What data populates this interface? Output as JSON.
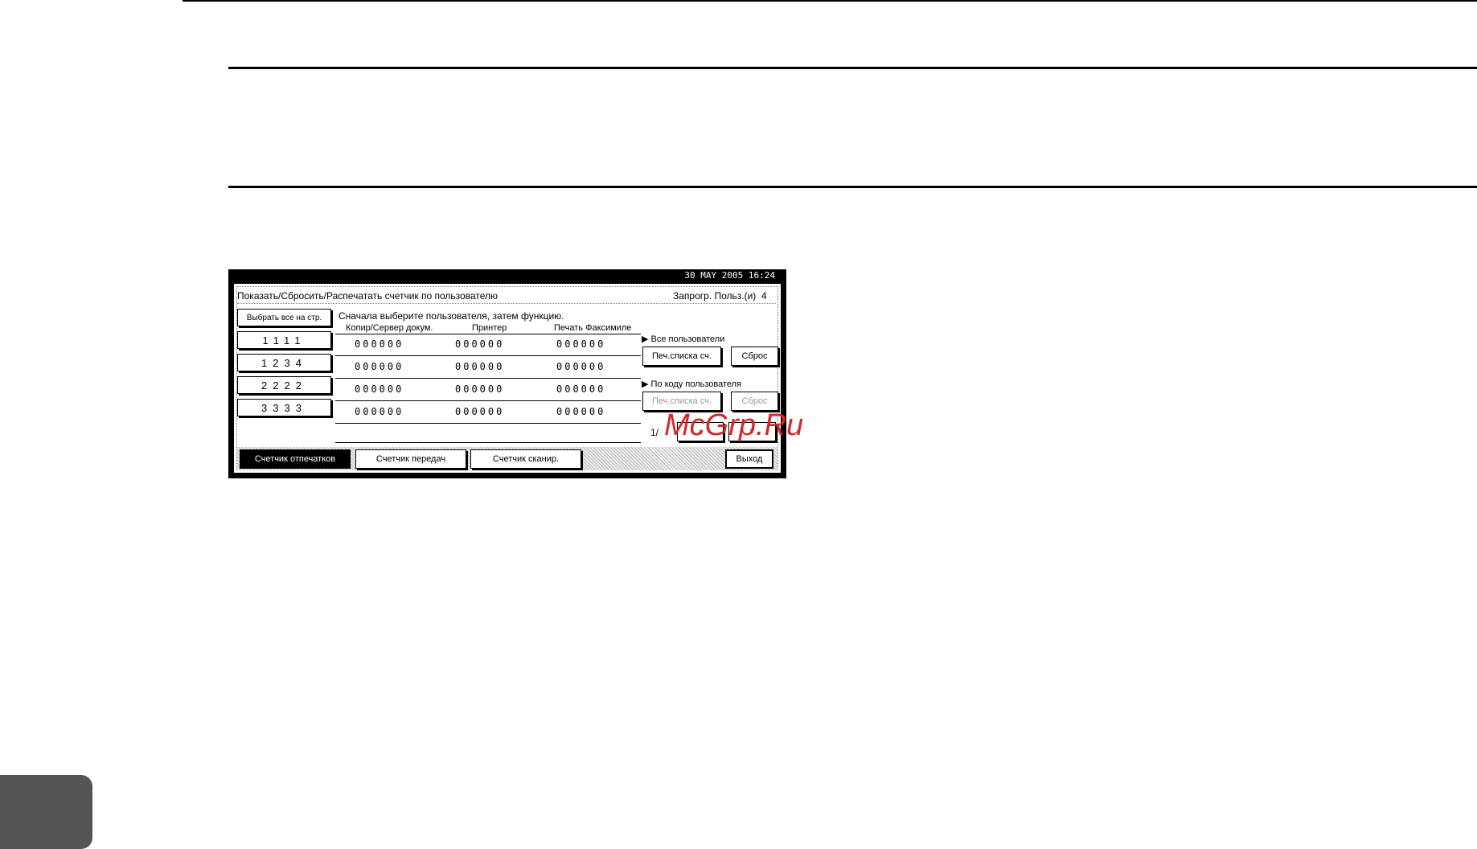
{
  "screen": {
    "datetime": "30 MAY  2005 16:24",
    "title": "Показать/Сбросить/Распечатать счетчик по пользователю",
    "registered_label": "Запрогр. Польз.(и)",
    "registered_count": "4",
    "select_all_label": "Выбрать все на стр.",
    "instruction": "Сначала выберите пользователя, затем функцию.",
    "columns": [
      "Копир/Сервер докум.",
      "Принтер",
      "Печать Факсимиле"
    ],
    "users": [
      {
        "code": "1111",
        "copy": "000000",
        "printer": "000000",
        "fax": "000000"
      },
      {
        "code": "1234",
        "copy": "000000",
        "printer": "000000",
        "fax": "000000"
      },
      {
        "code": "2222",
        "copy": "000000",
        "printer": "000000",
        "fax": "000000"
      },
      {
        "code": "3333",
        "copy": "000000",
        "printer": "000000",
        "fax": "000000"
      }
    ],
    "all_users_label": "▶ Все пользователи",
    "print_list_label": "Печ.списка сч.",
    "reset_label": "Сброс",
    "by_code_label": "▶ По коду пользователя",
    "page_indicator": "1/",
    "prev_label": "▲",
    "next_label": "▼",
    "tabs": [
      "Счетчик отпечатков",
      "Счетчик передач",
      "Счетчик сканир."
    ],
    "exit_label": "Выход"
  },
  "watermark": "McGrp.Ru"
}
